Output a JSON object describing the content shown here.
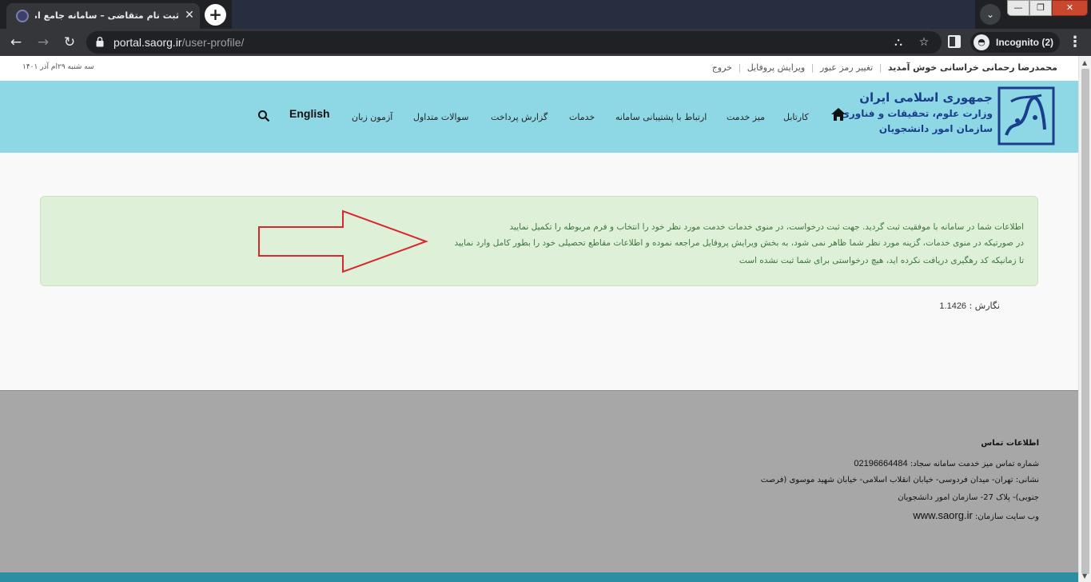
{
  "browser": {
    "tab_title": "ثبت نام متقاضی – سامانه جامع امور دانشجو",
    "new_tab_label": "+",
    "tab_close_label": "✕",
    "url_host": "portal.saorg.ir",
    "url_path": "/user-profile/",
    "incognito_label": "Incognito (2)"
  },
  "topbar": {
    "welcome": "محمدرضا رحمانی خراسانی خوش آمدید",
    "change_password": "تغییر رمز عبور",
    "edit_profile": "ویرایش پروفایل",
    "logout": "خروج",
    "date": "سه شنبه ۲۹ام آذر ۱۴۰۱"
  },
  "logo": {
    "line1": "جمهوری اسلامی ایران",
    "line2": "وزارت علوم، تحقیقات و فناوری",
    "line3": "سازمان امور دانشجویان"
  },
  "nav": {
    "items": [
      "کارتابل",
      "میز خدمت",
      "ارتباط با پشتیبانی سامانه",
      "خدمات",
      "گزارش پرداخت",
      "سوالات متداول",
      "آزمون زبان"
    ],
    "english": "English"
  },
  "alert": {
    "lines": [
      "اطلاعات شما در سامانه با موفقیت ثبت گردید. جهت ثبت درخواست، در منوی خدمات خدمت مورد نظر خود را انتخاب و فرم مربوطه را تکمیل نمایید",
      "در صورتیکه در منوی خدمات، گزینه مورد نظر شما ظاهر نمی شود، به بخش ویرایش پروفایل مراجعه نموده و اطلاعات مقاطع تحصیلی خود را بطور کامل وارد نمایید",
      "تا زمانیکه کد رهگیری دریافت نکرده اید، هیچ درخواستی برای شما ثبت نشده است"
    ]
  },
  "version": {
    "label": "نگارش :",
    "number": "1.1426"
  },
  "footer": {
    "title": "اطلاعات تماس",
    "phone_label": "شماره تماس میز خدمت سامانه سجاد:",
    "phone": "02196664484",
    "address_line1": "نشانی: تهران- میدان فردوسی- خیابان انقلاب اسلامی- خیابان شهید موسوی (فرصت",
    "address_line2": "جنوبی)- پلاک 27- سازمان امور دانشجویان",
    "website_label": "وب سایت سازمان:",
    "website": "www.saorg.ir"
  },
  "colors": {
    "header_bg": "#8ed8e6",
    "alert_bg": "#dff0d8",
    "alert_text": "#3c763d",
    "footer_bg": "#a7a7a7",
    "arrow": "#d9272e",
    "logo_blue": "#1b3e8c"
  },
  "icons": {
    "home": "home-icon",
    "search": "search-icon",
    "lock": "lock-icon",
    "star": "star-icon",
    "translate": "translate-icon"
  }
}
